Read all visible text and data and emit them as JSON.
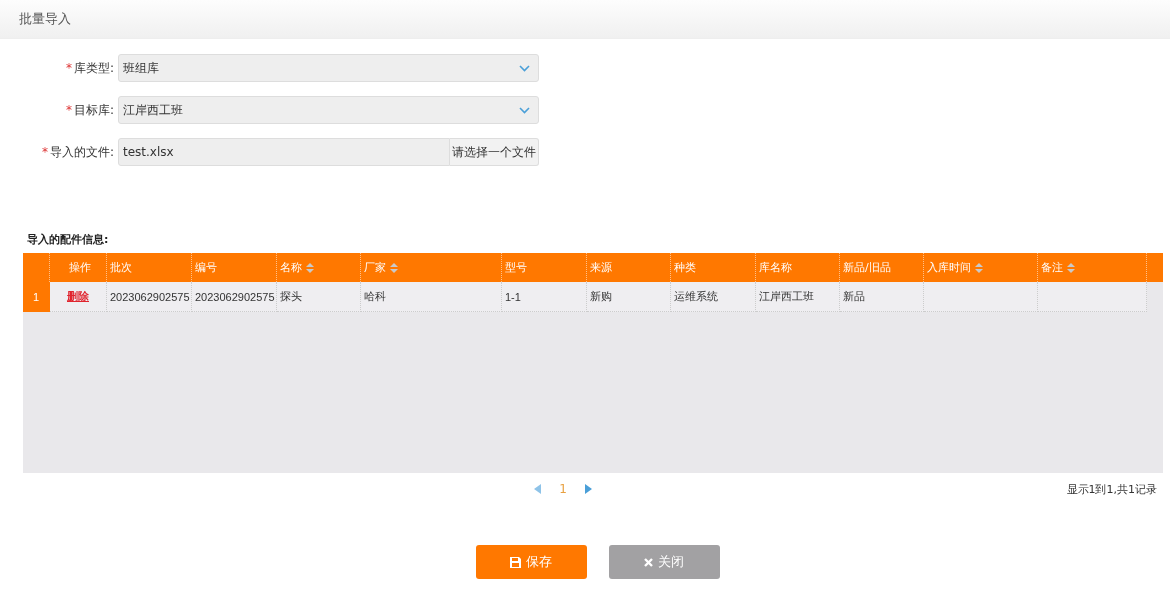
{
  "window": {
    "title": "批量导入"
  },
  "form": [
    {
      "kind": "select",
      "required_mark": "*",
      "label": "库类型:",
      "value": "班组库"
    },
    {
      "kind": "select",
      "required_mark": "*",
      "label": "目标库:",
      "value": "江岸西工班"
    },
    {
      "kind": "file",
      "required_mark": "*",
      "label": "导入的文件:",
      "value": "test.xlsx",
      "button": "请选择一个文件"
    }
  ],
  "section_title": "导入的配件信息:",
  "table": {
    "columns": [
      {
        "label": "操作",
        "sortable": false
      },
      {
        "label": "批次",
        "sortable": false
      },
      {
        "label": "编号",
        "sortable": false
      },
      {
        "label": "名称",
        "sortable": true
      },
      {
        "label": "厂家",
        "sortable": true
      },
      {
        "label": "型号",
        "sortable": false
      },
      {
        "label": "来源",
        "sortable": false
      },
      {
        "label": "种类",
        "sortable": false
      },
      {
        "label": "库名称",
        "sortable": false
      },
      {
        "label": "新品/旧品",
        "sortable": false
      },
      {
        "label": "入库时间",
        "sortable": true
      },
      {
        "label": "备注",
        "sortable": true
      }
    ],
    "rows": [
      {
        "number": "1",
        "cells": [
          "删除",
          "2023062902575",
          "2023062902575",
          "探头",
          "哈科",
          "1-1",
          "新购",
          "运维系统",
          "江岸西工班",
          "新品",
          "",
          ""
        ]
      }
    ]
  },
  "pagination": {
    "pages": [
      {
        "label": "1",
        "selected": true
      }
    ],
    "summary": "显示1到1,共1记录"
  },
  "buttons": [
    {
      "kind": "primary",
      "label": "保存"
    },
    {
      "kind": "secondary",
      "label": "关闭"
    }
  ]
}
